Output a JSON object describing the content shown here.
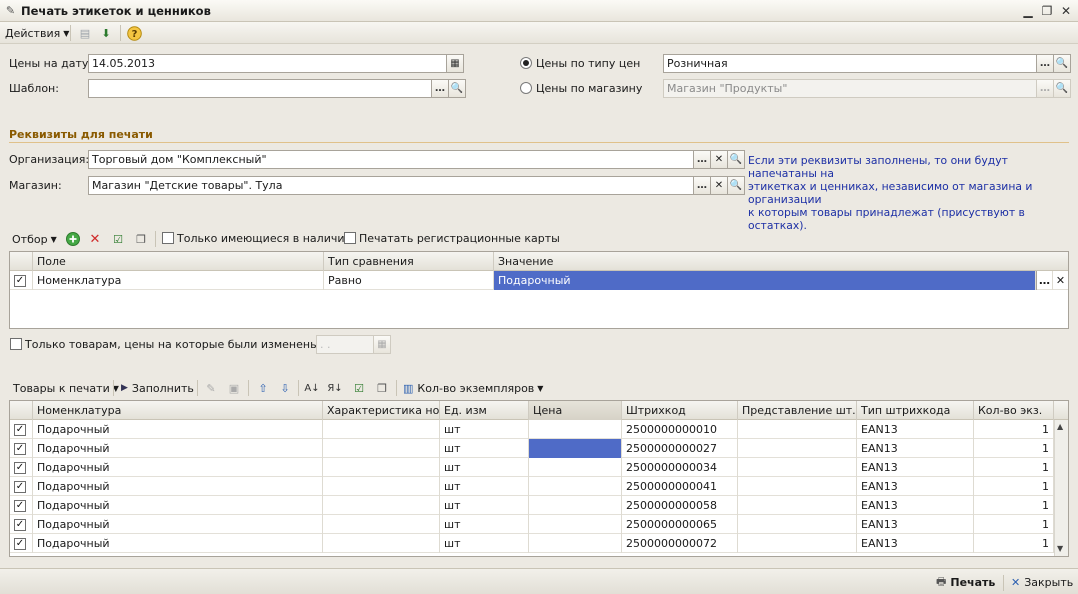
{
  "window": {
    "title": "Печать этикеток и ценников"
  },
  "toolbar": {
    "actions_label": "Действия"
  },
  "form": {
    "price_date_label": "Цены на дату:",
    "price_date_value": "14.05.2013",
    "template_label": "Шаблон:",
    "template_value": "",
    "radio_price_type_label": "Цены по типу цен",
    "price_type_value": "Розничная",
    "radio_store_label": "Цены по магазину",
    "store_price_value": "Магазин \"Продукты\""
  },
  "requisites": {
    "section_title": "Реквизиты для печати",
    "org_label": "Организация:",
    "org_value": "Торговый дом \"Комплексный\"",
    "store_label": "Магазин:",
    "store_value": "Магазин \"Детские товары\". Тула",
    "info_line1": "Если эти реквизиты заполнены, то они будут напечатаны на",
    "info_line2": "этикетках и ценниках, независимо от магазина и организации",
    "info_line3": "к которым товары принадлежат (присуствуют в остатках)."
  },
  "filter": {
    "selection_label": "Отбор",
    "only_in_stock_label": "Только имеющиеся в наличии",
    "print_reg_cards_label": "Печатать регистрационные карты",
    "columns": [
      "Поле",
      "Тип сравнения",
      "Значение"
    ],
    "rows": [
      {
        "field": "Номенклатура",
        "comparison": "Равно",
        "value": "Подарочный",
        "checked": true
      }
    ]
  },
  "price_changed": {
    "label": "Только товарам, цены на которые были изменены с",
    "date_placeholder": " .  .    "
  },
  "goods_toolbar": {
    "goods_to_print_label": "Товары к печати",
    "fill_label": "Заполнить",
    "copies_label": "Кол-во экземпляров"
  },
  "goods_table": {
    "columns": [
      "Номенклатура",
      "Характеристика но...",
      "Ед. изм",
      "Цена",
      "Штрихкод",
      "Представление шт...",
      "Тип штрихкода",
      "Кол-во экз."
    ],
    "rows": [
      {
        "name": "Подарочный",
        "characteristic": "",
        "unit": "шт",
        "price": "",
        "barcode": "2500000000010",
        "repr": "",
        "barcode_type": "EAN13",
        "qty": "1"
      },
      {
        "name": "Подарочный",
        "characteristic": "",
        "unit": "шт",
        "price": "",
        "barcode": "2500000000027",
        "repr": "",
        "barcode_type": "EAN13",
        "qty": "1"
      },
      {
        "name": "Подарочный",
        "characteristic": "",
        "unit": "шт",
        "price": "",
        "barcode": "2500000000034",
        "repr": "",
        "barcode_type": "EAN13",
        "qty": "1"
      },
      {
        "name": "Подарочный",
        "characteristic": "",
        "unit": "шт",
        "price": "",
        "barcode": "2500000000041",
        "repr": "",
        "barcode_type": "EAN13",
        "qty": "1"
      },
      {
        "name": "Подарочный",
        "characteristic": "",
        "unit": "шт",
        "price": "",
        "barcode": "2500000000058",
        "repr": "",
        "barcode_type": "EAN13",
        "qty": "1"
      },
      {
        "name": "Подарочный",
        "characteristic": "",
        "unit": "шт",
        "price": "",
        "barcode": "2500000000065",
        "repr": "",
        "barcode_type": "EAN13",
        "qty": "1"
      },
      {
        "name": "Подарочный",
        "characteristic": "",
        "unit": "шт",
        "price": "",
        "barcode": "2500000000072",
        "repr": "",
        "barcode_type": "EAN13",
        "qty": "1"
      }
    ]
  },
  "bottom": {
    "print_label": "Печать",
    "close_label": "Закрыть"
  },
  "colors": {
    "selection": "#4f6bc7",
    "section_title": "#8a5a00",
    "info_text": "#1c2fa5"
  }
}
